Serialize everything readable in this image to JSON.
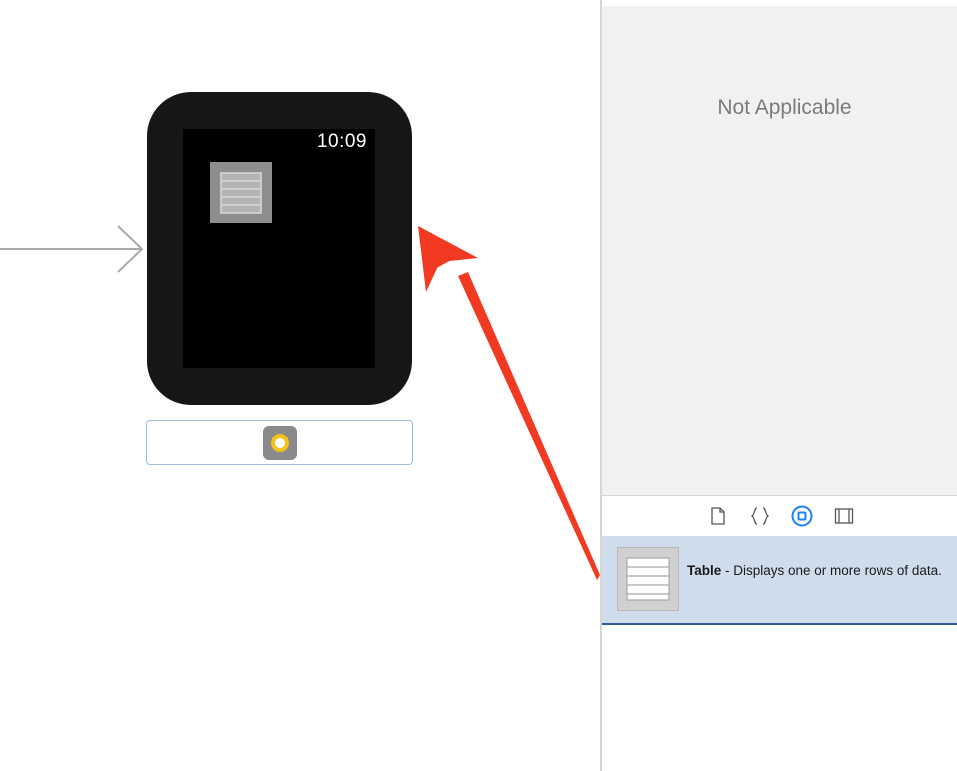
{
  "watch": {
    "time": "10:09"
  },
  "inspector": {
    "not_applicable": "Not Applicable",
    "library_tabs": [
      {
        "icon": "file-template-icon"
      },
      {
        "icon": "code-snippet-icon"
      },
      {
        "icon": "object-library-icon",
        "selected": true
      },
      {
        "icon": "media-library-icon"
      }
    ],
    "library_item": {
      "name": "Table",
      "description": " - Displays one or more rows of data."
    }
  },
  "colors": {
    "annotation_arrow": "#f23a22",
    "selection_background": "#cfdcec",
    "selected_tab": "#1a82f7",
    "controller_ring": "#f6c21a"
  }
}
